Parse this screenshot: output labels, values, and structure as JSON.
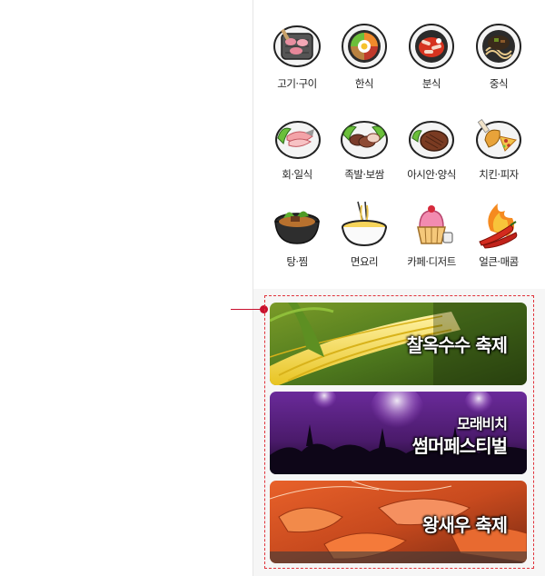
{
  "categories": [
    {
      "label": "고기·구이",
      "icon": "grilled-meat-icon"
    },
    {
      "label": "한식",
      "icon": "bibimbap-icon"
    },
    {
      "label": "분식",
      "icon": "tteokbokki-icon"
    },
    {
      "label": "중식",
      "icon": "jajangmyeon-icon"
    },
    {
      "label": "회·일식",
      "icon": "sashimi-icon"
    },
    {
      "label": "족발·보쌈",
      "icon": "jokbal-icon"
    },
    {
      "label": "아시안·양식",
      "icon": "steak-icon"
    },
    {
      "label": "치킨·피자",
      "icon": "chicken-pizza-icon"
    },
    {
      "label": "탕·찜",
      "icon": "stew-pot-icon"
    },
    {
      "label": "면요리",
      "icon": "noodle-bowl-icon"
    },
    {
      "label": "카페·디저트",
      "icon": "cupcake-icon"
    },
    {
      "label": "얼큰·매콤",
      "icon": "hot-pepper-icon"
    }
  ],
  "festivals": {
    "corn": {
      "title": "찰옥수수 축제"
    },
    "beach": {
      "subtitle": "모래비치",
      "title": "썸머페스티벌"
    },
    "shrimp": {
      "title": "왕새우 축제"
    }
  },
  "colors": {
    "accent": "#c8102e",
    "dashed_border": "#e0323a"
  }
}
